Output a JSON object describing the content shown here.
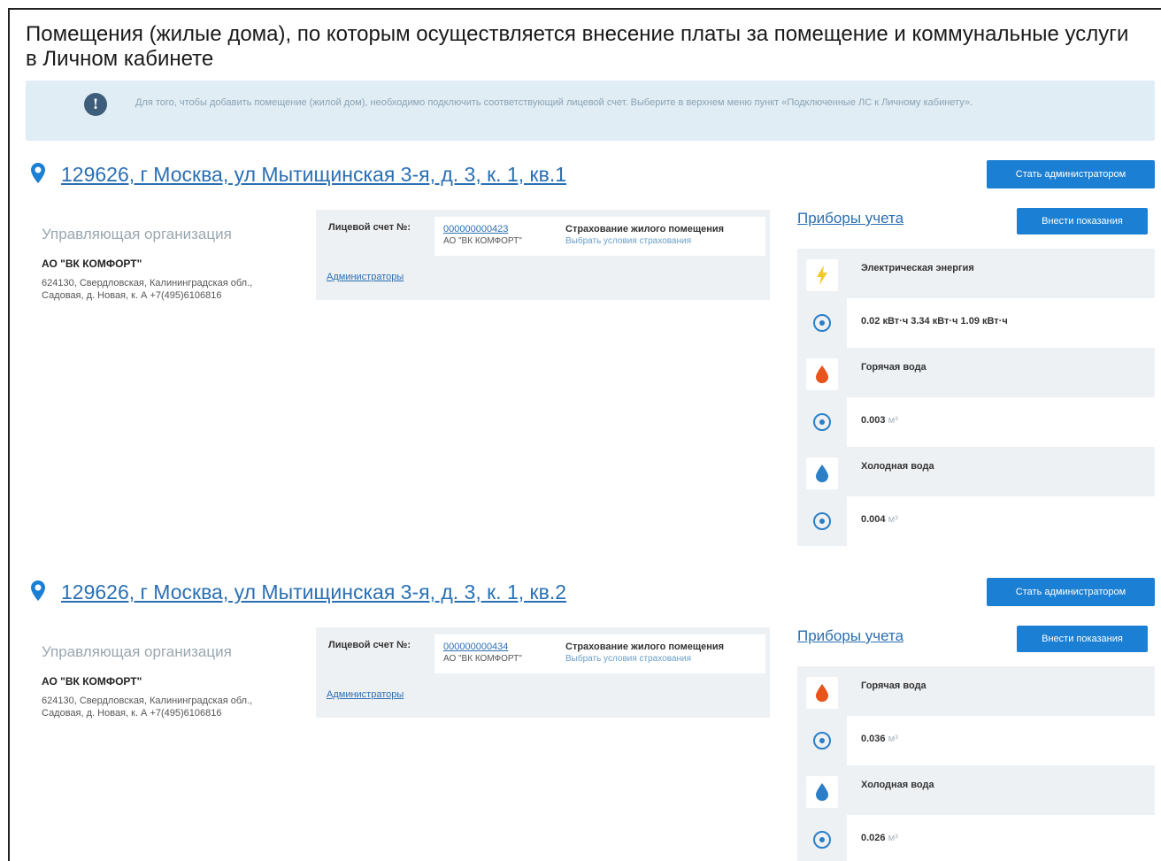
{
  "page_title": "Помещения (жилые дома), по которым осуществляется внесение платы за помещение и коммунальные услуги в Личном кабинете",
  "info": {
    "text": "Для того, чтобы добавить помещение (жилой дом), необходимо подключить соответствующий лицевой счет. Выберите в верхнем меню пункт «Подключенные ЛС к Личному кабинету»."
  },
  "labels": {
    "become_admin": "Стать администратором",
    "org_heading": "Управляющая организация",
    "account_label": "Лицевой счет №:",
    "insurance_title": "Страхование жилого помещения",
    "insurance_link": "Выбрать условия страхования",
    "admins_link": "Администраторы",
    "meters_title": "Приборы учета",
    "enter_readings": "Внести показания"
  },
  "properties": [
    {
      "address": "129626, г Москва, ул Мытищинская 3-я, д. 3, к. 1, кв.1",
      "org_name": "АО \"ВК КОМФОРТ\"",
      "org_details": "624130, Свердловская, Калининградская обл., Садовая, д. Новая, к. А +7(495)6106816",
      "account_number": "000000000423",
      "account_org": "АО \"ВК КОМФОРТ\"",
      "meters": [
        {
          "icon": "lightning-icon",
          "name": "Электрическая энергия",
          "reading": "0.02",
          "unit": "кВт·ч",
          "reading_full": "0.02 кВт·ч 3.34 кВт·ч 1.09 кВт·ч"
        },
        {
          "icon": "hot-water-drop-icon",
          "name": "Горячая вода",
          "reading": "0.003",
          "unit": "м³"
        },
        {
          "icon": "cold-water-drop-icon",
          "name": "Холодная вода",
          "reading": "0.004",
          "unit": "м³"
        }
      ]
    },
    {
      "address": "129626, г Москва, ул Мытищинская 3-я, д. 3, к. 1, кв.2",
      "org_name": "АО \"ВК КОМФОРТ\"",
      "org_details": "624130, Свердловская, Калининградская обл., Садовая, д. Новая, к. А +7(495)6106816",
      "account_number": "000000000434",
      "account_org": "АО \"ВК КОМФОРТ\"",
      "meters": [
        {
          "icon": "hot-water-drop-icon",
          "name": "Горячая вода",
          "reading": "0.036",
          "unit": "м³"
        },
        {
          "icon": "cold-water-drop-icon",
          "name": "Холодная вода",
          "reading": "0.026",
          "unit": "м³"
        }
      ]
    }
  ],
  "colors": {
    "accent": "#1b7fd3",
    "link": "#2a6fb3",
    "info_bg": "#e1edf5",
    "card_bg": "#eef1f4",
    "lightning": "#f3c92a",
    "hot_water": "#e8541c",
    "cold_water": "#2a7fc7"
  }
}
